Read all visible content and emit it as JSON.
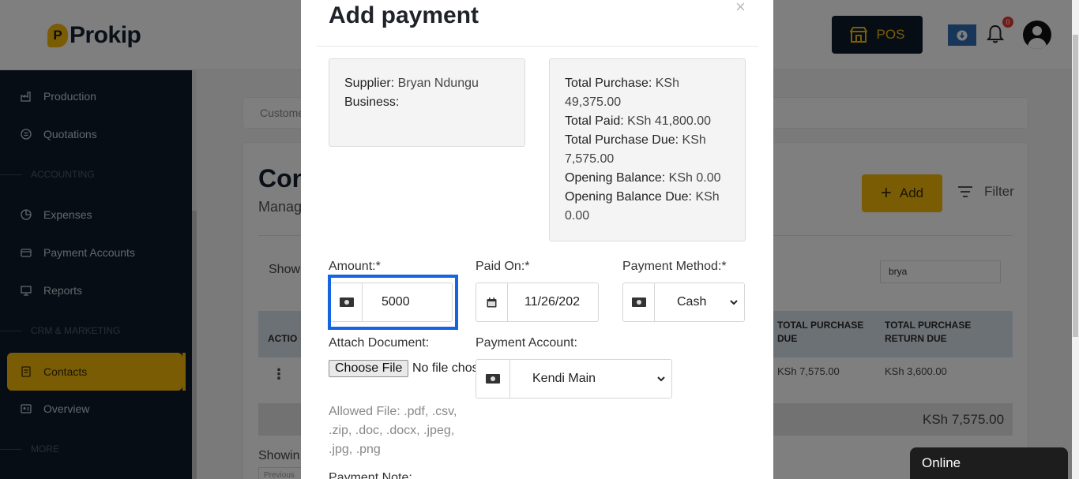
{
  "app": {
    "logo_text": "Prokip",
    "logo_mark": "P"
  },
  "topbar": {
    "pos_label": "POS",
    "notification_count": "0"
  },
  "sidebar": {
    "items": [
      {
        "label": "Production",
        "icon": "factory-icon"
      },
      {
        "label": "Quotations",
        "icon": "document-icon"
      },
      {
        "section": "ACCOUNTING"
      },
      {
        "label": "Expenses",
        "icon": "pie-chart-icon"
      },
      {
        "label": "Payment Accounts",
        "icon": "wallet-icon"
      },
      {
        "label": "Reports",
        "icon": "presentation-icon"
      },
      {
        "section": "CRM & MARKETING"
      },
      {
        "label": "Contacts",
        "icon": "contacts-icon",
        "active": true
      },
      {
        "label": "Overview",
        "icon": "id-card-icon"
      },
      {
        "section": "MORE"
      }
    ]
  },
  "page": {
    "breadcrumb": "Custome",
    "title": "Con",
    "subtitle": "Manag",
    "add_label": "Add",
    "filter_label": "Filter",
    "show_label": "Show",
    "search_value": "brya",
    "table": {
      "headers": {
        "action": "ACTIO",
        "purchase_due": "TOTAL PURCHASE DUE",
        "return_due": "TOTAL PURCHASE RETURN DUE"
      },
      "row": {
        "purchase_due": "KSh 7,575.00",
        "return_due": "KSh 3,600.00"
      },
      "footer_total": "KSh 7,575.00"
    },
    "showing_label": "Showin",
    "previous_label": "Previous"
  },
  "modal": {
    "title": "Add payment",
    "close": "×",
    "supplier_label": "Supplier:",
    "supplier_value": "Bryan Ndungu",
    "business_label": "Business:",
    "summary": {
      "total_purchase_label": "Total Purchase:",
      "total_purchase_value": "KSh 49,375.00",
      "total_paid_label": "Total Paid:",
      "total_paid_value": "KSh 41,800.00",
      "total_purchase_due_label": "Total Purchase Due:",
      "total_purchase_due_value": "KSh 7,575.00",
      "opening_balance_label": "Opening Balance:",
      "opening_balance_value": "KSh 0.00",
      "opening_balance_due_label": "Opening Balance Due:",
      "opening_balance_due_value": "KSh 0.00"
    },
    "amount_label": "Amount:*",
    "amount_value": "5000",
    "paid_on_label": "Paid On:*",
    "paid_on_value": "11/26/202",
    "payment_method_label": "Payment Method:*",
    "payment_method_value": "Cash",
    "attach_label": "Attach Document:",
    "choose_file_label": "Choose File",
    "no_file_label": "No file chosen",
    "payment_account_label": "Payment Account:",
    "payment_account_value": "Kendi Main",
    "allowed_files": "Allowed File: .pdf, .csv, .zip, .doc, .docx, .jpeg, .jpg, .png",
    "payment_note_label": "Payment Note:"
  },
  "chat": {
    "status": "Online"
  },
  "colors": {
    "accent": "#f5b80b",
    "sidebar_bg": "#0d1b2a",
    "focus_outline": "#1565e0"
  }
}
